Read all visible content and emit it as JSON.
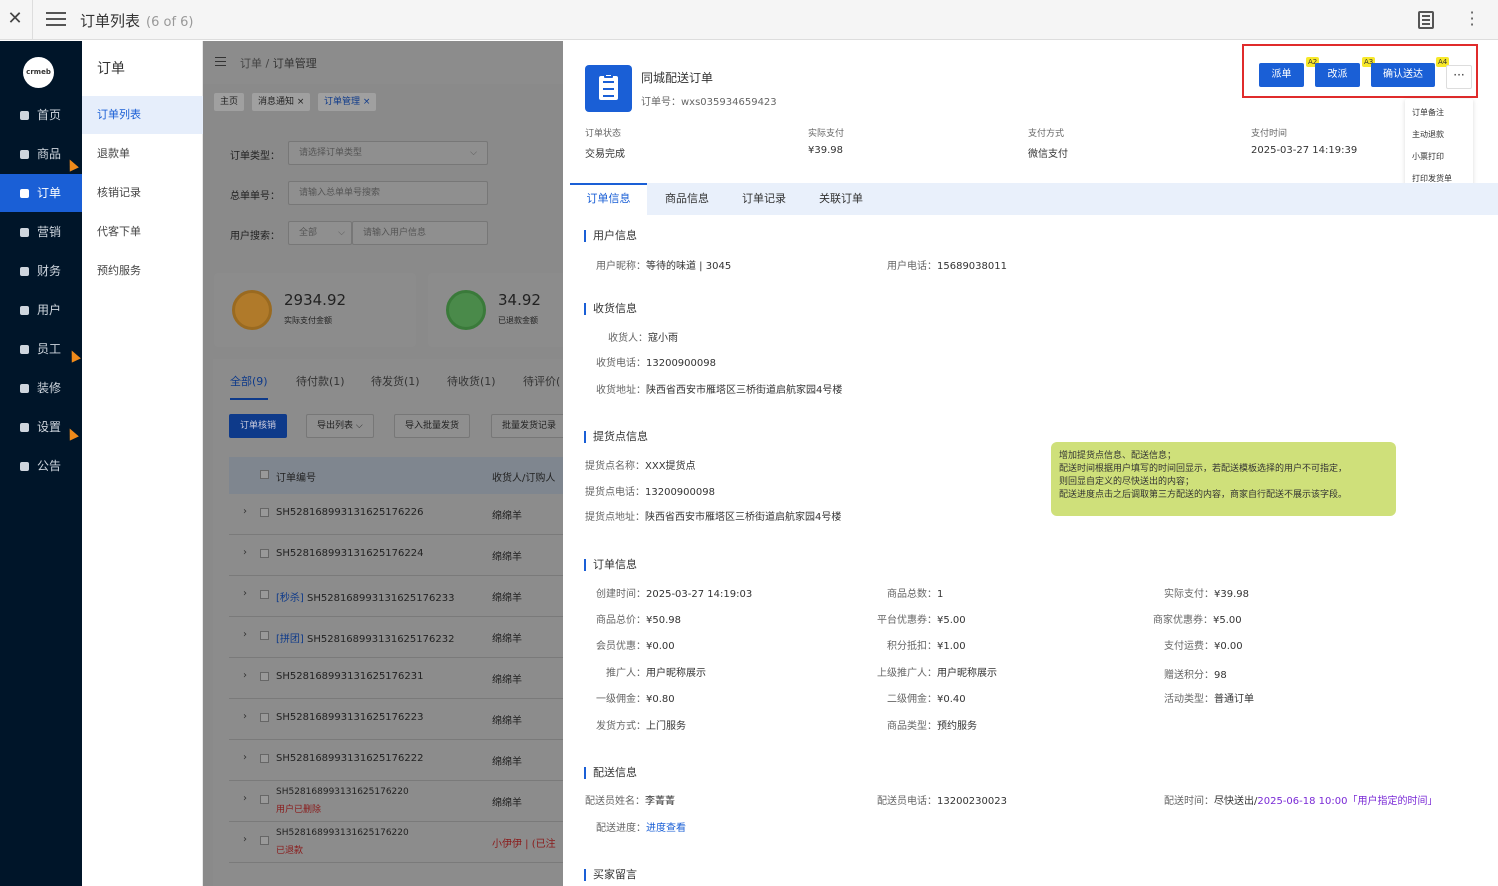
{
  "window": {
    "title": "订单列表",
    "count": "(6 of 6)"
  },
  "logo": {
    "text": "crmeb"
  },
  "nav": [
    {
      "label": "首页",
      "active": false
    },
    {
      "label": "商品",
      "active": false
    },
    {
      "label": "订单",
      "active": true
    },
    {
      "label": "营销",
      "active": false
    },
    {
      "label": "财务",
      "active": false
    },
    {
      "label": "用户",
      "active": false
    },
    {
      "label": "员工",
      "active": false
    },
    {
      "label": "装修",
      "active": false
    },
    {
      "label": "设置",
      "active": false
    },
    {
      "label": "公告",
      "active": false
    }
  ],
  "subnav": {
    "title": "订单",
    "items": [
      "订单列表",
      "退款单",
      "核销记录",
      "代客下单",
      "预约服务"
    ]
  },
  "breadcrumb": {
    "parent": "订单 /",
    "current": "订单管理"
  },
  "tags": [
    "主页",
    "消息通知 ×",
    "订单管理 ×"
  ],
  "filters": {
    "order_type_label": "订单类型：",
    "order_type_placeholder": "请选择订单类型",
    "total_no_label": "总单单号：",
    "total_no_placeholder": "请输入总单单号搜索",
    "user_search_label": "用户搜索：",
    "user_search_select": "全部",
    "user_search_placeholder": "请输入用户信息"
  },
  "stats": [
    {
      "value": "2934.92",
      "label": "实际支付金额",
      "color": "#e8a53a"
    },
    {
      "value": "34.92",
      "label": "已退款金额",
      "color": "#5cb85c"
    }
  ],
  "list_tabs": [
    "全部(9)",
    "待付款(1)",
    "待发货(1)",
    "待收货(1)",
    "待评价("
  ],
  "list_buttons": [
    "订单核销",
    "导出列表 ⌵",
    "导入批量发货",
    "批量发货记录"
  ],
  "table": {
    "headers": [
      "订单编号",
      "收货人/订购人"
    ],
    "rows": [
      {
        "prefix": "",
        "no": "SH528168993131625176226",
        "sub": "",
        "buyer": "绵绵羊"
      },
      {
        "prefix": "",
        "no": "SH528168993131625176224",
        "sub": "",
        "buyer": "绵绵羊"
      },
      {
        "prefix": "[秒杀] ",
        "no": "SH528168993131625176233",
        "sub": "",
        "buyer": "绵绵羊"
      },
      {
        "prefix": "[拼团] ",
        "no": "SH528168993131625176232",
        "sub": "",
        "buyer": "绵绵羊"
      },
      {
        "prefix": "",
        "no": "SH528168993131625176231",
        "sub": "",
        "buyer": "绵绵羊"
      },
      {
        "prefix": "",
        "no": "SH528168993131625176223",
        "sub": "",
        "buyer": "绵绵羊"
      },
      {
        "prefix": "",
        "no": "SH528168993131625176222",
        "sub": "",
        "buyer": "绵绵羊"
      },
      {
        "prefix": "",
        "no": "SH528168993131625176220",
        "sub": "用户已删除",
        "buyer": "绵绵羊"
      },
      {
        "prefix": "",
        "no": "SH528168993131625176220",
        "sub": "已退款",
        "buyer": "小伊伊 | (已注"
      }
    ]
  },
  "drawer": {
    "title": "同城配送订单",
    "order_no": "订单号：wxs035934659423",
    "buttons": [
      {
        "label": "派单",
        "badge": "A2"
      },
      {
        "label": "改派",
        "badge": "A3"
      },
      {
        "label": "确认送达",
        "badge": "A4"
      }
    ],
    "more": "···",
    "dropdown": [
      "订单备注",
      "主动退款",
      "小票打印",
      "打印发货单"
    ],
    "summary": [
      {
        "label": "订单状态",
        "value": "交易完成"
      },
      {
        "label": "实际支付",
        "value": "¥39.98"
      },
      {
        "label": "支付方式",
        "value": "微信支付"
      },
      {
        "label": "支付时间",
        "value": "2025-03-27 14:19:39"
      }
    ],
    "tabs": [
      "订单信息",
      "商品信息",
      "订单记录",
      "关联订单"
    ],
    "user_info": {
      "title": "用户信息",
      "nickname_k": "用户昵称：",
      "nickname_v": "等待的味道 | 3045",
      "phone_k": "用户电话：",
      "phone_v": "15689038011"
    },
    "receiver": {
      "title": "收货信息",
      "name_k": "收货人：",
      "name_v": "寇小雨",
      "phone_k": "收货电话：",
      "phone_v": "13200900098",
      "addr_k": "收货地址：",
      "addr_v": "陕西省西安市雁塔区三桥街道启航家园4号楼"
    },
    "pickup": {
      "title": "提货点信息",
      "name_k": "提货点名称：",
      "name_v": "XXX提货点",
      "phone_k": "提货点电话：",
      "phone_v": "13200900098",
      "addr_k": "提货点地址：",
      "addr_v": "陕西省西安市雁塔区三桥街道启航家园4号楼"
    },
    "note": [
      "增加提货点信息、配送信息；",
      "配送时间根据用户填写的时间回显示，若配送模板选择的用户不可指定，",
      "则回显自定义的尽快送出的内容；",
      "配送进度点击之后调取第三方配送的内容，商家自行配送不展示该字段。"
    ],
    "order_info": {
      "title": "订单信息",
      "c1": [
        {
          "k": "创建时间：",
          "v": "2025-03-27 14:19:03"
        },
        {
          "k": "商品总价：",
          "v": "¥50.98"
        },
        {
          "k": "会员优惠：",
          "v": "¥0.00"
        },
        {
          "k": "推广人：",
          "v": "用户昵称展示"
        },
        {
          "k": "一级佣金：",
          "v": "¥0.80"
        },
        {
          "k": "发货方式：",
          "v": "上门服务"
        }
      ],
      "c2": [
        {
          "k": "商品总数：",
          "v": "1"
        },
        {
          "k": "平台优惠券：",
          "v": "¥5.00"
        },
        {
          "k": "积分抵扣：",
          "v": "¥1.00"
        },
        {
          "k": "上级推广人：",
          "v": "用户昵称展示"
        },
        {
          "k": "二级佣金：",
          "v": "¥0.40"
        },
        {
          "k": "商品类型：",
          "v": "预约服务"
        }
      ],
      "c3": [
        {
          "k": "实际支付：",
          "v": "¥39.98"
        },
        {
          "k": "商家优惠券：",
          "v": "¥5.00"
        },
        {
          "k": "支付运费：",
          "v": "¥0.00"
        },
        {
          "k": "赠送积分：",
          "v": "98"
        },
        {
          "k": "活动类型：",
          "v": "普通订单"
        }
      ]
    },
    "delivery": {
      "title": "配送信息",
      "name_k": "配送员姓名：",
      "name_v": "李菁菁",
      "phone_k": "配送员电话：",
      "phone_v": "13200230023",
      "time_k": "配送时间：",
      "time_v1": "尽快送出/",
      "time_v2": "2025-06-18 10:00「用户指定的时间」",
      "progress_k": "配送进度：",
      "progress_v": "进度查看"
    },
    "buyer_msg": {
      "title": "买家留言"
    }
  },
  "colors": {
    "primary": "#1a5fd6",
    "sidebar": "#001529",
    "highlight": "#e02b2b",
    "note": "#cfe07a"
  }
}
